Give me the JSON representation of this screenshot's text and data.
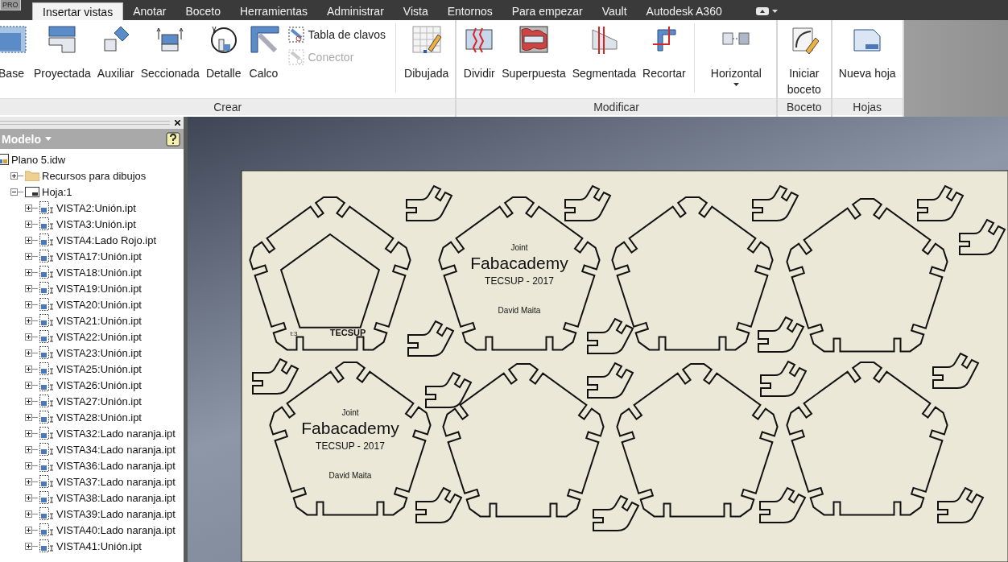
{
  "app_badge": "PRO",
  "tabs": [
    {
      "label": "Insertar vistas",
      "selected": true
    },
    {
      "label": "Anotar",
      "selected": false
    },
    {
      "label": "Boceto",
      "selected": false
    },
    {
      "label": "Herramientas",
      "selected": false
    },
    {
      "label": "Administrar",
      "selected": false
    },
    {
      "label": "Vista",
      "selected": false
    },
    {
      "label": "Entornos",
      "selected": false
    },
    {
      "label": "Para empezar",
      "selected": false
    },
    {
      "label": "Vault",
      "selected": false
    },
    {
      "label": "Autodesk A360",
      "selected": false
    }
  ],
  "ribbon": [
    {
      "label": "Crear",
      "items": [
        {
          "kind": "large",
          "label": "Base"
        },
        {
          "kind": "large",
          "label": "Proyectada"
        },
        {
          "kind": "large",
          "label": "Auxiliar"
        },
        {
          "kind": "large",
          "label": "Seccionada"
        },
        {
          "kind": "large",
          "label": "Detalle"
        },
        {
          "kind": "large",
          "label": "Calco"
        },
        {
          "kind": "small_stack",
          "buttons": [
            {
              "label": "Tabla de clavos",
              "disabled": false
            },
            {
              "label": "Conector",
              "disabled": true
            }
          ]
        },
        {
          "kind": "separator"
        },
        {
          "kind": "large",
          "label": "Dibujada"
        }
      ]
    },
    {
      "label": "Modificar",
      "items": [
        {
          "kind": "large",
          "label": "Dividir"
        },
        {
          "kind": "large",
          "label": "Superpuesta"
        },
        {
          "kind": "large",
          "label": "Segmentada"
        },
        {
          "kind": "large",
          "label": "Recortar"
        },
        {
          "kind": "separator"
        },
        {
          "kind": "dropdown",
          "label": "Horizontal"
        }
      ]
    },
    {
      "label": "Boceto",
      "items": [
        {
          "kind": "large",
          "label": "Iniciar boceto"
        }
      ]
    },
    {
      "label": "Hojas",
      "items": [
        {
          "kind": "large",
          "label": "Nueva hoja"
        }
      ]
    }
  ],
  "browser": {
    "title": "Modelo",
    "tree": [
      {
        "label": "Plano 5.idw",
        "kind": "drawing",
        "children": [
          {
            "label": "Recursos para dibujos",
            "kind": "folder",
            "expanded": false
          },
          {
            "label": "Hoja:1",
            "kind": "sheet",
            "expanded": true,
            "children": [
              {
                "label": "VISTA2:Unión.ipt",
                "kind": "view",
                "expanded": false
              },
              {
                "label": "VISTA3:Unión.ipt",
                "kind": "view",
                "expanded": false
              },
              {
                "label": "VISTA4:Lado Rojo.ipt",
                "kind": "view",
                "expanded": false
              },
              {
                "label": "VISTA17:Unión.ipt",
                "kind": "view",
                "expanded": false
              },
              {
                "label": "VISTA18:Unión.ipt",
                "kind": "view",
                "expanded": false
              },
              {
                "label": "VISTA19:Unión.ipt",
                "kind": "view",
                "expanded": false
              },
              {
                "label": "VISTA20:Unión.ipt",
                "kind": "view",
                "expanded": false
              },
              {
                "label": "VISTA21:Unión.ipt",
                "kind": "view",
                "expanded": false
              },
              {
                "label": "VISTA22:Unión.ipt",
                "kind": "view",
                "expanded": false
              },
              {
                "label": "VISTA23:Unión.ipt",
                "kind": "view",
                "expanded": false
              },
              {
                "label": "VISTA25:Unión.ipt",
                "kind": "view",
                "expanded": false
              },
              {
                "label": "VISTA26:Unión.ipt",
                "kind": "view",
                "expanded": false
              },
              {
                "label": "VISTA27:Unión.ipt",
                "kind": "view",
                "expanded": false
              },
              {
                "label": "VISTA28:Unión.ipt",
                "kind": "view",
                "expanded": false
              },
              {
                "label": "VISTA32:Lado naranja.ipt",
                "kind": "view",
                "expanded": false
              },
              {
                "label": "VISTA34:Lado naranja.ipt",
                "kind": "view",
                "expanded": false
              },
              {
                "label": "VISTA36:Lado naranja.ipt",
                "kind": "view",
                "expanded": false
              },
              {
                "label": "VISTA37:Lado naranja.ipt",
                "kind": "view",
                "expanded": false
              },
              {
                "label": "VISTA38:Lado naranja.ipt",
                "kind": "view",
                "expanded": false
              },
              {
                "label": "VISTA39:Lado naranja.ipt",
                "kind": "view",
                "expanded": false
              },
              {
                "label": "VISTA40:Lado naranja.ipt",
                "kind": "view",
                "expanded": false
              },
              {
                "label": "VISTA41:Unión.ipt",
                "kind": "view",
                "expanded": false
              }
            ]
          }
        ]
      }
    ]
  },
  "sheet": {
    "pieces": [
      {
        "kind": "ring",
        "label": "TECSUP",
        "thickness": "t:3"
      },
      {
        "kind": "engraved",
        "subtitle": "Joint",
        "title": "Fabacademy",
        "organization": "TECSUP - 2017",
        "author": "David Maita"
      },
      {
        "kind": "plain"
      },
      {
        "kind": "plain"
      },
      {
        "kind": "engraved",
        "subtitle": "Joint",
        "title": "Fabacademy",
        "organization": "TECSUP - 2017",
        "author": "David Maita"
      },
      {
        "kind": "plain"
      },
      {
        "kind": "plain"
      },
      {
        "kind": "plain"
      }
    ]
  }
}
